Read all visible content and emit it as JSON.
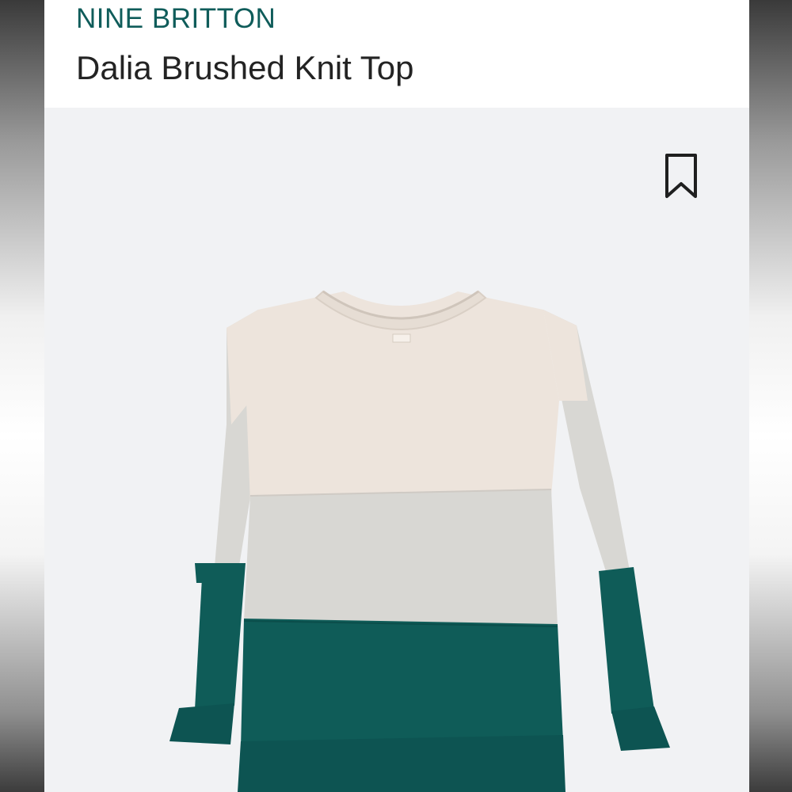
{
  "header": {
    "brand": "NINE BRITTON",
    "product_title": "Dalia Brushed Knit Top"
  },
  "icons": {
    "bookmark": "bookmark-icon"
  },
  "colors": {
    "brand_text": "#0f5c5a",
    "title_text": "#232323",
    "image_background": "#f1f2f4",
    "stripe_top": "#ede4dc",
    "stripe_middle": "#d8d7d3",
    "stripe_bottom": "#0f5c58"
  }
}
